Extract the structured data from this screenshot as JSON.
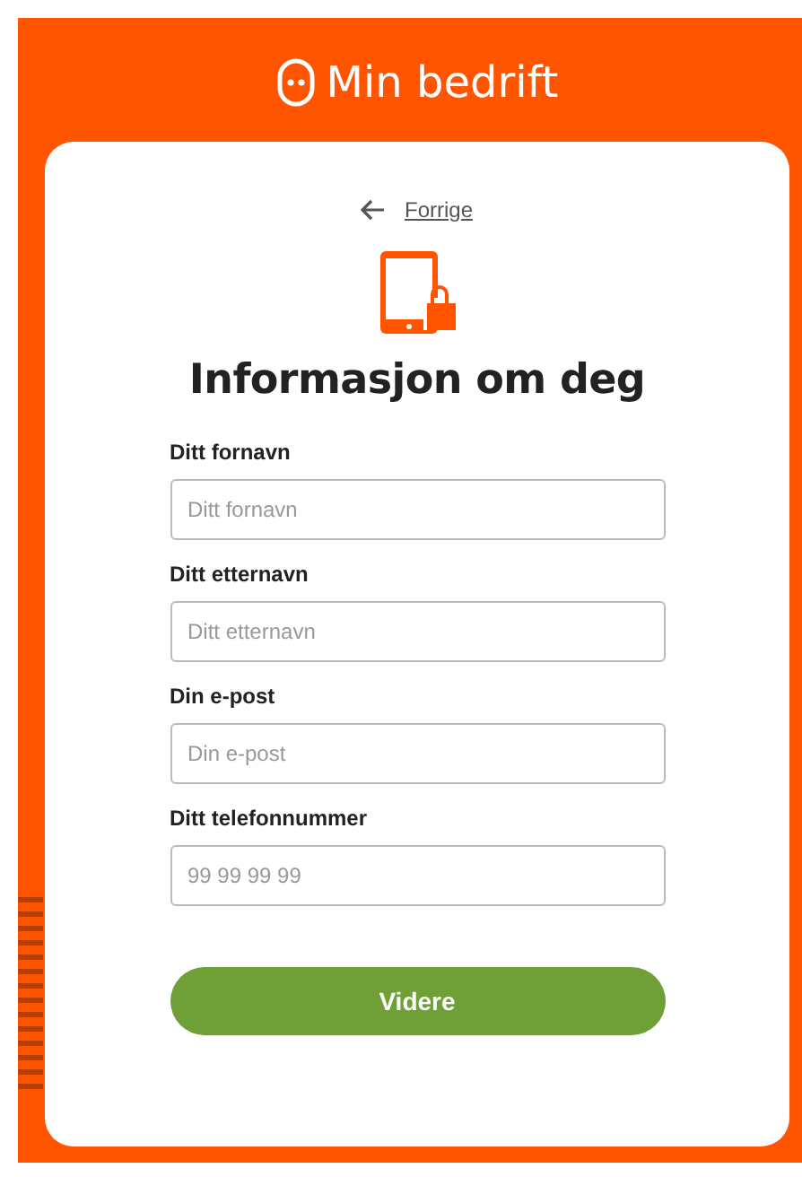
{
  "header": {
    "logo_text": "Min bedrift"
  },
  "back_link": {
    "label": "Forrige"
  },
  "title": "Informasjon om deg",
  "fields": [
    {
      "label": "Ditt fornavn",
      "placeholder": "Ditt fornavn"
    },
    {
      "label": "Ditt etternavn",
      "placeholder": "Ditt etternavn"
    },
    {
      "label": "Din e-post",
      "placeholder": "Din e-post"
    },
    {
      "label": "Ditt telefonnummer",
      "placeholder": "99 99 99 99"
    }
  ],
  "submit_button": "Videre"
}
